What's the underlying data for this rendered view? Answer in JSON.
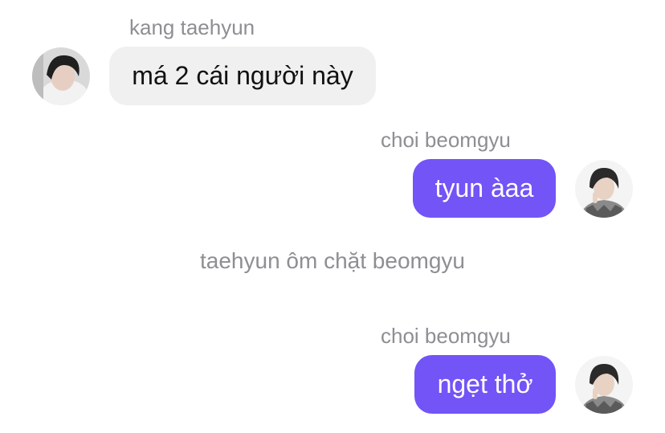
{
  "messages": [
    {
      "sender": "kang taehyun",
      "text": "má 2 cái người này",
      "side": "incoming",
      "avatar_icon": "taehyun-avatar"
    },
    {
      "sender": "choi beomgyu",
      "text": "tyun àaa",
      "side": "outgoing",
      "avatar_icon": "beomgyu-avatar"
    },
    {
      "system": "taehyun ôm chặt beomgyu"
    },
    {
      "sender": "choi beomgyu",
      "text": "ngẹt thở",
      "side": "outgoing",
      "avatar_icon": "beomgyu-avatar"
    }
  ],
  "colors": {
    "outgoing_bubble": "#7354f6",
    "incoming_bubble": "#f0f0f0",
    "meta_text": "#8e8e93"
  }
}
